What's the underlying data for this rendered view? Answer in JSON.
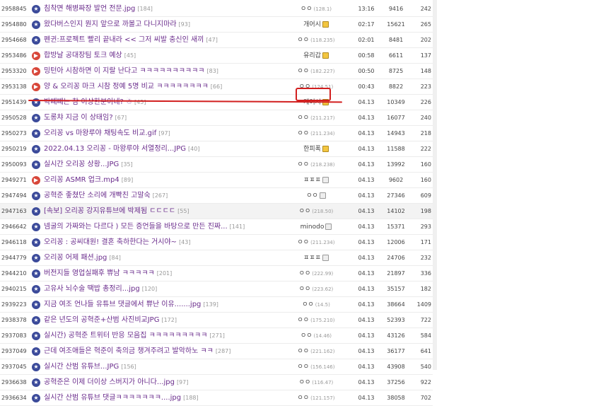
{
  "rows": [
    {
      "num": "2958845",
      "title": "침착면 해병짜장 발언 전문.jpg",
      "comments": "[184]",
      "writer": "ㅇㅇ",
      "ip": "(128.1)",
      "badge": "",
      "date": "13:16",
      "views": "9416",
      "rec": "242",
      "icon": "star"
    },
    {
      "num": "2954880",
      "title": "왔다버스인지 뭔지 앞으로 까볼고 다니지마라",
      "comments": "[93]",
      "writer": "개어시",
      "ip": "",
      "badge": "gold",
      "date": "02:17",
      "views": "15621",
      "rec": "265",
      "icon": "star"
    },
    {
      "num": "2954668",
      "title": "펜귄:프로젝트 빨리 끝내라 << 그저 씨발 충신인 새끼",
      "comments": "[47]",
      "writer": "ㅇㅇ",
      "ip": "(118.235)",
      "badge": "",
      "date": "02:01",
      "views": "8481",
      "rec": "202",
      "icon": "star"
    },
    {
      "num": "2953486",
      "title": "합방날 공대장팀 토크 예상",
      "comments": "[45]",
      "writer": "유리갑",
      "ip": "",
      "badge": "gold",
      "date": "00:58",
      "views": "6611",
      "rec": "137",
      "icon": "red"
    },
    {
      "num": "2953320",
      "title": "밍턴아 시참하면 이 지랄 난다고 ㅋㅋㅋㅋㅋㅋㅋㅋㅋㅋ",
      "comments": "[83]",
      "writer": "ㅇㅇ",
      "ip": "(182.227)",
      "badge": "",
      "date": "00:50",
      "views": "8725",
      "rec": "148",
      "icon": "red"
    },
    {
      "num": "2953138",
      "title": "양 & 오리꽁 마크 시참 정예 5명 비교 ㅋㅋㅋㅋㅋㅋㅋㅋ",
      "comments": "[66]",
      "writer": "ㅇㅇ",
      "ip": "(124.51)",
      "badge": "",
      "date": "00:43",
      "views": "8822",
      "rec": "223",
      "icon": "red"
    },
    {
      "num": "2951439",
      "title": "박빼빼는 참 이상한분이네? ☃",
      "comments": "[45]",
      "writer": "개어시",
      "ip": "",
      "badge": "gold",
      "date": "04.13",
      "views": "10349",
      "rec": "226",
      "icon": "star"
    },
    {
      "num": "2950528",
      "title": "도롱챠 지금 이 상태임?",
      "comments": "[67]",
      "writer": "ㅇㅇ",
      "ip": "(211.217)",
      "badge": "",
      "date": "04.13",
      "views": "16077",
      "rec": "240",
      "icon": "star"
    },
    {
      "num": "2950273",
      "title": "오리꽁 vs 마왕루야 채팅속도 비교.gif",
      "comments": "[97]",
      "writer": "ㅇㅇ",
      "ip": "(211.234)",
      "badge": "",
      "date": "04.13",
      "views": "14943",
      "rec": "218",
      "icon": "star"
    },
    {
      "num": "2950219",
      "title": "2022.04.13 오리꽁 - 마왕루야 서열정리...JPG",
      "comments": "[40]",
      "writer": "한피폭",
      "ip": "",
      "badge": "gold",
      "date": "04.13",
      "views": "11588",
      "rec": "222",
      "icon": "star"
    },
    {
      "num": "2950093",
      "title": "실시간 오리꽁 상황...JPG",
      "comments": "[35]",
      "writer": "ㅇㅇ",
      "ip": "(218.238)",
      "badge": "",
      "date": "04.13",
      "views": "13992",
      "rec": "160",
      "icon": "star"
    },
    {
      "num": "2949271",
      "title": "오리꽁 ASMR 업크.mp4",
      "comments": "[89]",
      "writer": "ㅍㅍㅍ",
      "ip": "",
      "badge": "gray",
      "date": "04.13",
      "views": "9602",
      "rec": "160",
      "icon": "red"
    },
    {
      "num": "2947494",
      "title": "공혁준 좋쳤단 소리에 개빡친 고말숙",
      "comments": "[267]",
      "writer": "ㅇㅇ",
      "ip": "",
      "badge": "gray",
      "date": "04.13",
      "views": "27346",
      "rec": "609",
      "icon": "star"
    },
    {
      "num": "2947163",
      "title": "[속보] 오리꽁 강지유튜브에 박제됨 ㄷㄷㄷㄷ",
      "comments": "[55]",
      "writer": "ㅇㅇ",
      "ip": "(218.50)",
      "badge": "",
      "date": "04.13",
      "views": "14102",
      "rec": "198",
      "icon": "star",
      "hl": true
    },
    {
      "num": "2946642",
      "title": "넴굴의 가짜와는 다르다 ) 모든 증언들을 바탕으로 만든 진짜...",
      "comments": "[141]",
      "writer": "minodo",
      "ip": "",
      "badge": "gray",
      "date": "04.13",
      "views": "15371",
      "rec": "293",
      "icon": "star"
    },
    {
      "num": "2946118",
      "title": "오리꽁 : 공씨대원! 결혼 축하한다는 거시야~",
      "comments": "[43]",
      "writer": "ㅇㅇ",
      "ip": "(211.234)",
      "badge": "",
      "date": "04.13",
      "views": "12006",
      "rec": "171",
      "icon": "star"
    },
    {
      "num": "2944779",
      "title": "오리꽁 어제 패션.jpg",
      "comments": "[84]",
      "writer": "ㅍㅍㅍ",
      "ip": "",
      "badge": "gray",
      "date": "04.13",
      "views": "24706",
      "rec": "232",
      "icon": "star"
    },
    {
      "num": "2944210",
      "title": "버전지들 영업실패후 쀼남 ㅋㅋㅋㅋㅋ",
      "comments": "[201]",
      "writer": "ㅇㅇ",
      "ip": "(222.99)",
      "badge": "",
      "date": "04.13",
      "views": "21897",
      "rec": "336",
      "icon": "star"
    },
    {
      "num": "2940215",
      "title": "고유사 뇌수술 땍밥 총정리...jpg",
      "comments": "[120]",
      "writer": "ㅇㅇ",
      "ip": "(223.62)",
      "badge": "",
      "date": "04.13",
      "views": "35157",
      "rec": "182",
      "icon": "star"
    },
    {
      "num": "2939223",
      "title": "지금 여조 언나들 유튜브 댓글에서 쀼난 이유.......jpg",
      "comments": "[139]",
      "writer": "ㅇㅇ",
      "ip": "(14.5)",
      "badge": "",
      "date": "04.13",
      "views": "38664",
      "rec": "1409",
      "icon": "star"
    },
    {
      "num": "2938378",
      "title": "같은 년도의 공혁준+산범 사진비교JPG",
      "comments": "[172]",
      "writer": "ㅇㅇ",
      "ip": "(175.210)",
      "badge": "",
      "date": "04.13",
      "views": "52393",
      "rec": "722",
      "icon": "star"
    },
    {
      "num": "2937083",
      "title": "실시간) 공혁준 트위터 반응 모음집 ㅋㅋㅋㅋㅋㅋㅋㅋㅋ",
      "comments": "[271]",
      "writer": "ㅇㅇ",
      "ip": "(14.46)",
      "badge": "",
      "date": "04.13",
      "views": "43126",
      "rec": "584",
      "icon": "star"
    },
    {
      "num": "2937049",
      "title": "근데 여조애들은 혁준이 축의금 챙겨주려고 발악하노 ㅋㅋ",
      "comments": "[287]",
      "writer": "ㅇㅇ",
      "ip": "(221.162)",
      "badge": "",
      "date": "04.13",
      "views": "36177",
      "rec": "641",
      "icon": "star"
    },
    {
      "num": "2937045",
      "title": "실시간 산범 유튜브...JPG",
      "comments": "[156]",
      "writer": "ㅇㅇ",
      "ip": "(156.146)",
      "badge": "",
      "date": "04.13",
      "views": "43908",
      "rec": "540",
      "icon": "star"
    },
    {
      "num": "2936638",
      "title": "공혁준은 이제 더이상 스버지가 아니다...jpg",
      "comments": "[97]",
      "writer": "ㅇㅇ",
      "ip": "(116.47)",
      "badge": "",
      "date": "04.13",
      "views": "37256",
      "rec": "922",
      "icon": "star"
    },
    {
      "num": "2936634",
      "title": "실시간 산범 유튜브 댓글ㅋㅋㅋㅋㅋㅋㅋ....jpg",
      "comments": "[188]",
      "writer": "ㅇㅇ",
      "ip": "(121.157)",
      "badge": "",
      "date": "04.13",
      "views": "38058",
      "rec": "702",
      "icon": "star"
    }
  ]
}
